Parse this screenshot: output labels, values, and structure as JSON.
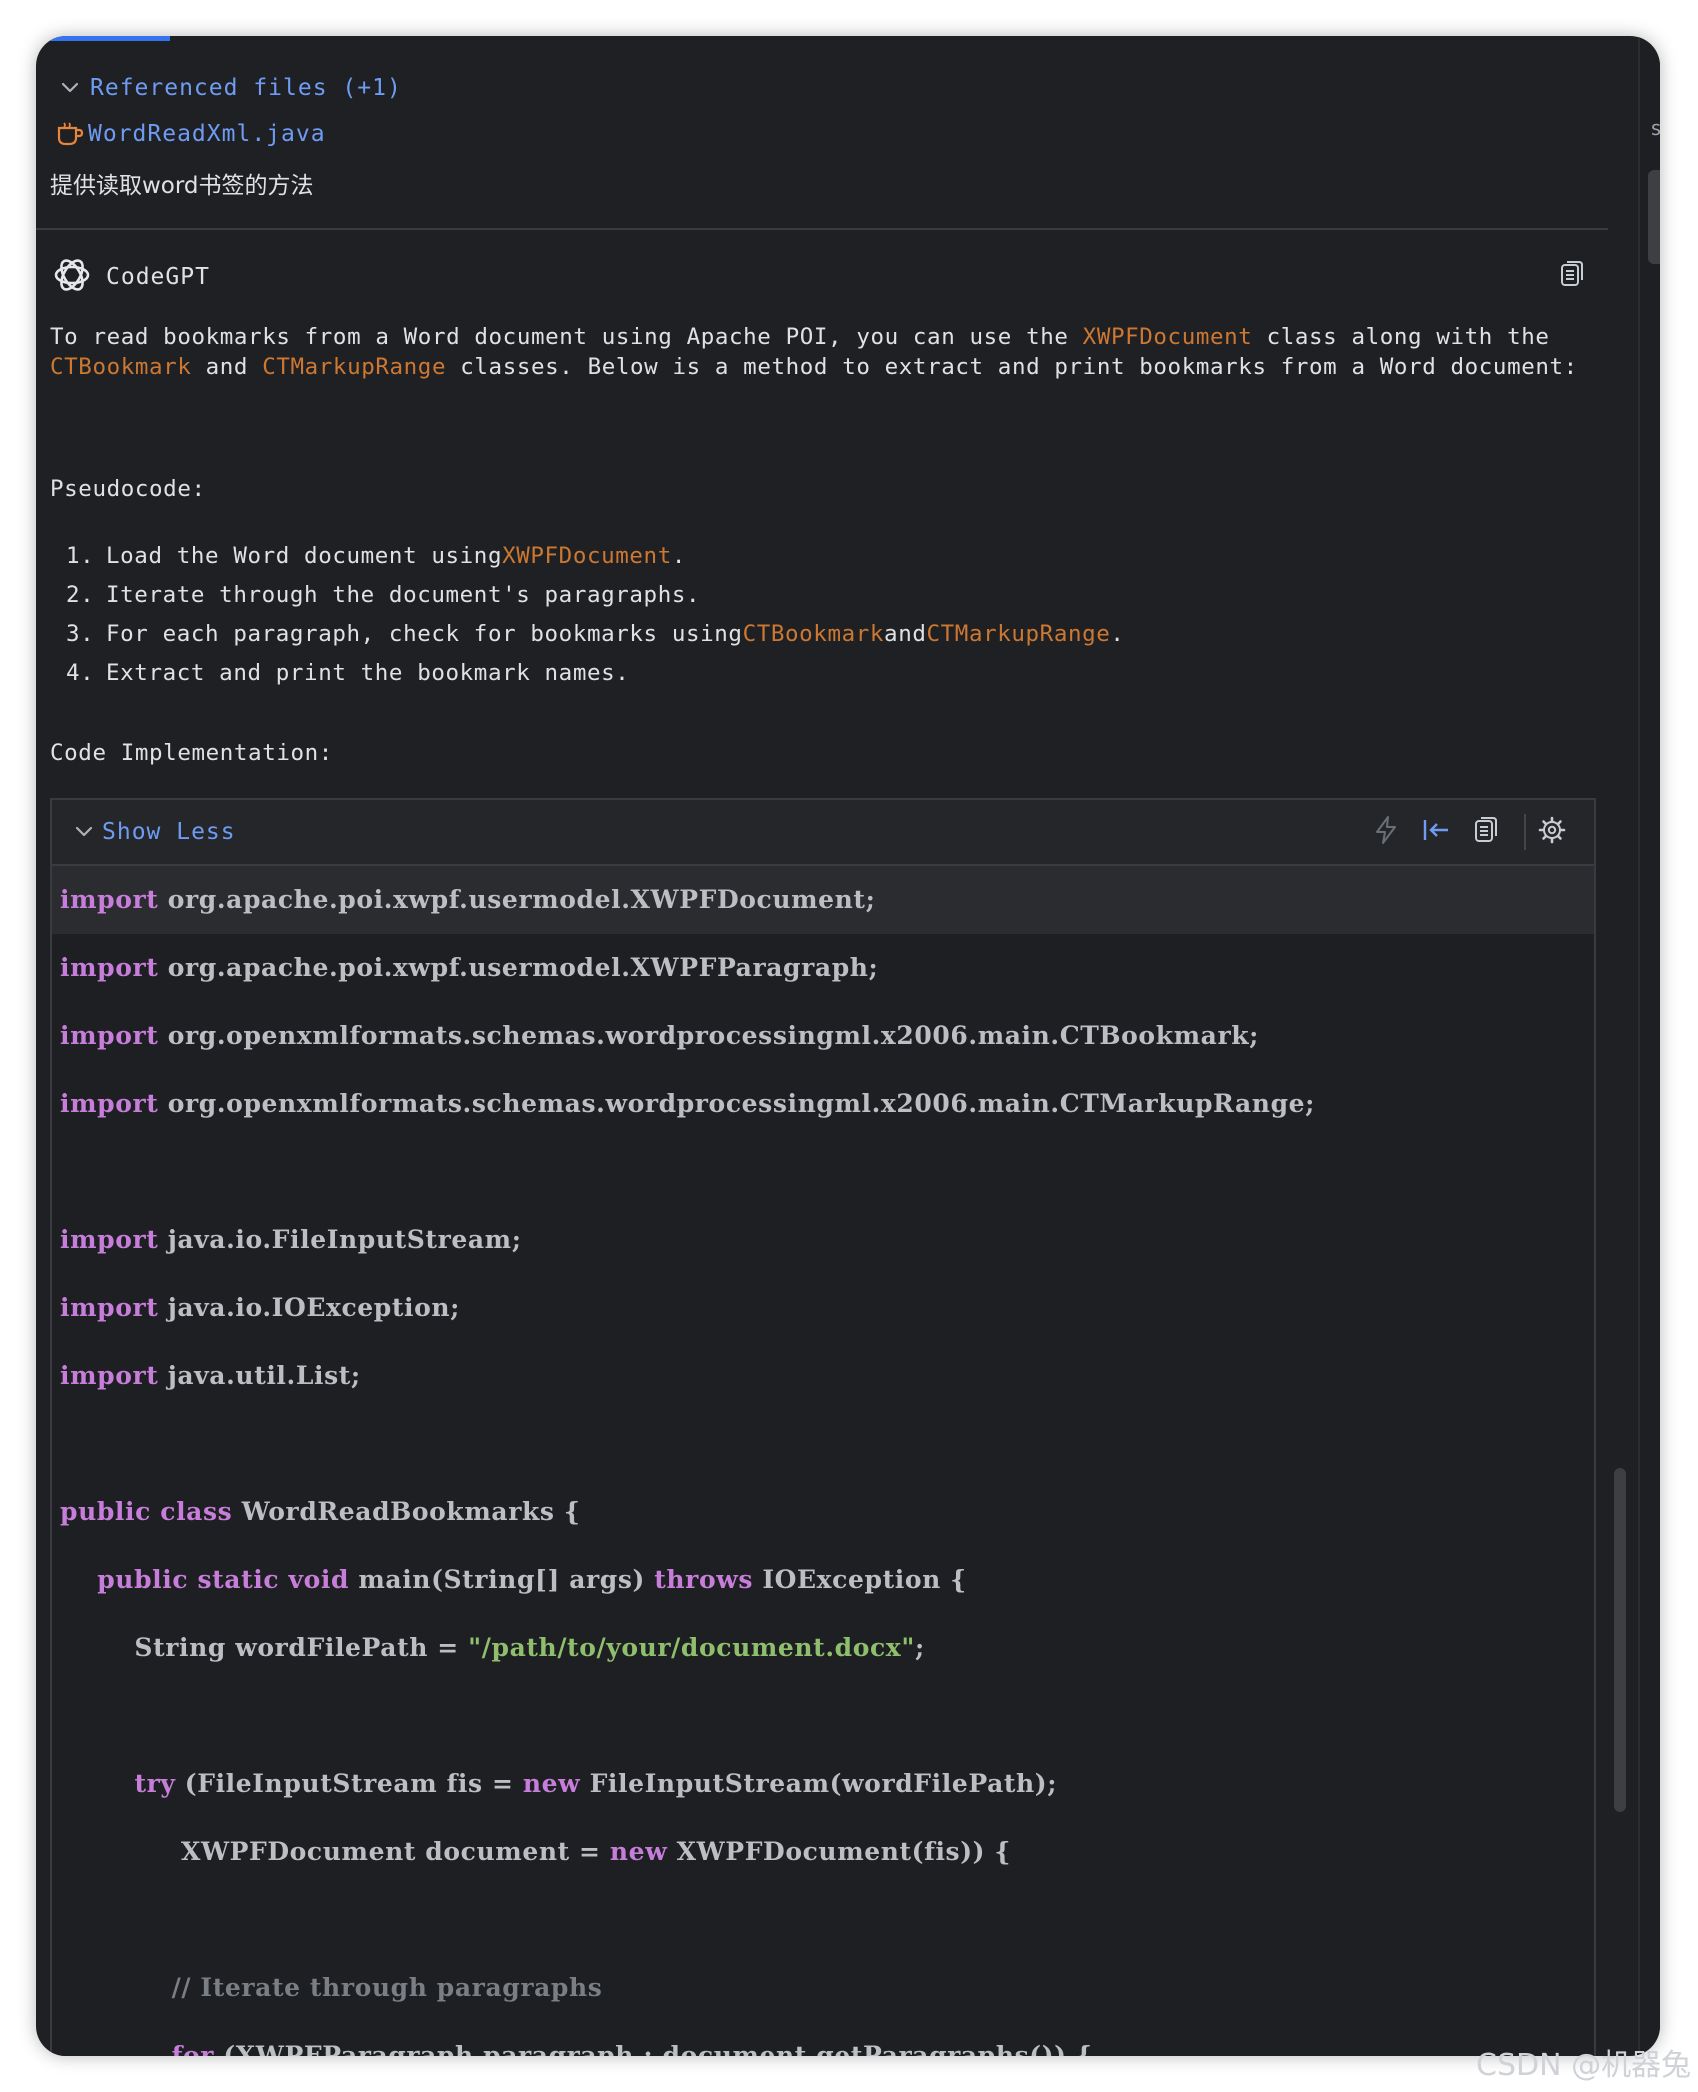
{
  "referenced": {
    "header_label": "Referenced files (+1)",
    "file_name": "WordReadXml.java"
  },
  "user_message": "提供读取word书签的方法",
  "assistant": {
    "name": "CodeGPT",
    "intro": {
      "p1": "To read bookmarks from a Word document using Apache POI, you can use the ",
      "c1": "XWPFDocument",
      "p2": " class along with the ",
      "c2": "CTBookmark",
      "p3": " and ",
      "c3": "CTMarkupRange",
      "p4": " classes. Below is a method to extract and print bookmarks from a Word document:"
    },
    "pseudocode_label": "Pseudocode:",
    "steps": [
      {
        "num": "1.",
        "t1": "Load the Word document using ",
        "c1": "XWPFDocument",
        "t2": "."
      },
      {
        "num": "2.",
        "t1": "Iterate through the document's paragraphs."
      },
      {
        "num": "3.",
        "t1": "For each paragraph, check for bookmarks using ",
        "c1": "CTBookmark",
        "t2": " and ",
        "c2": "CTMarkupRange",
        "t3": "."
      },
      {
        "num": "4.",
        "t1": "Extract and print the bookmark names."
      }
    ],
    "code_label": "Code Implementation:"
  },
  "code_block": {
    "toggle_label": "Show Less",
    "lines": [
      {
        "seg": [
          {
            "k": "kw",
            "t": "import"
          },
          {
            "k": "plain",
            "t": " org.apache.poi.xwpf.usermodel.XWPFDocument;"
          }
        ]
      },
      {
        "seg": [
          {
            "k": "kw",
            "t": "import"
          },
          {
            "k": "plain",
            "t": " org.apache.poi.xwpf.usermodel.XWPFParagraph;"
          }
        ]
      },
      {
        "seg": [
          {
            "k": "kw",
            "t": "import"
          },
          {
            "k": "plain",
            "t": " org.openxmlformats.schemas.wordprocessingml.x2006.main.CTBookmark;"
          }
        ]
      },
      {
        "seg": [
          {
            "k": "kw",
            "t": "import"
          },
          {
            "k": "plain",
            "t": " org.openxmlformats.schemas.wordprocessingml.x2006.main.CTMarkupRange;"
          }
        ]
      },
      {
        "seg": []
      },
      {
        "seg": [
          {
            "k": "kw",
            "t": "import"
          },
          {
            "k": "plain",
            "t": " java.io.FileInputStream;"
          }
        ]
      },
      {
        "seg": [
          {
            "k": "kw",
            "t": "import"
          },
          {
            "k": "plain",
            "t": " java.io.IOException;"
          }
        ]
      },
      {
        "seg": [
          {
            "k": "kw",
            "t": "import"
          },
          {
            "k": "plain",
            "t": " java.util.List;"
          }
        ]
      },
      {
        "seg": []
      },
      {
        "seg": [
          {
            "k": "kw",
            "t": "public class"
          },
          {
            "k": "plain",
            "t": " WordReadBookmarks {"
          }
        ]
      },
      {
        "seg": [
          {
            "k": "plain",
            "t": "    "
          },
          {
            "k": "kw",
            "t": "public static void"
          },
          {
            "k": "plain",
            "t": " main(String[] args) "
          },
          {
            "k": "kw",
            "t": "throws"
          },
          {
            "k": "plain",
            "t": " IOException {"
          }
        ]
      },
      {
        "seg": [
          {
            "k": "plain",
            "t": "        String wordFilePath = "
          },
          {
            "k": "str",
            "t": "\"/path/to/your/document.docx\""
          },
          {
            "k": "plain",
            "t": ";"
          }
        ]
      },
      {
        "seg": []
      },
      {
        "seg": [
          {
            "k": "plain",
            "t": "        "
          },
          {
            "k": "kw",
            "t": "try"
          },
          {
            "k": "plain",
            "t": " (FileInputStream fis = "
          },
          {
            "k": "kw",
            "t": "new"
          },
          {
            "k": "plain",
            "t": " FileInputStream(wordFilePath);"
          }
        ]
      },
      {
        "seg": [
          {
            "k": "plain",
            "t": "             XWPFDocument document = "
          },
          {
            "k": "kw",
            "t": "new"
          },
          {
            "k": "plain",
            "t": " XWPFDocument(fis)) {"
          }
        ]
      },
      {
        "seg": []
      },
      {
        "seg": [
          {
            "k": "plain",
            "t": "            "
          },
          {
            "k": "cmt",
            "t": "// Iterate through paragraphs"
          }
        ]
      },
      {
        "seg": [
          {
            "k": "plain",
            "t": "            "
          },
          {
            "k": "kw",
            "t": "for"
          },
          {
            "k": "plain",
            "t": " (XWPFParagraph paragraph : document.getParagraphs()) {"
          }
        ]
      }
    ]
  },
  "watermark": "CSDN @机器兔",
  "side_strip_glyph": "s",
  "icons": {
    "ref_toggle": "chevron-down-icon",
    "java_file": "java-cup-icon",
    "bot_avatar": "openai-logo-icon",
    "copy_message": "copy-icon",
    "insert": "lightning-icon",
    "replace": "arrow-left-bar-icon",
    "copy_code": "copy-icon",
    "settings": "gear-icon"
  },
  "colors": {
    "background": "#1f2023",
    "link_blue": "#6f9cf3",
    "inline_code": "#cc7832",
    "keyword": "#c77dda",
    "string": "#8fbf6c",
    "comment": "#7a7e85"
  }
}
